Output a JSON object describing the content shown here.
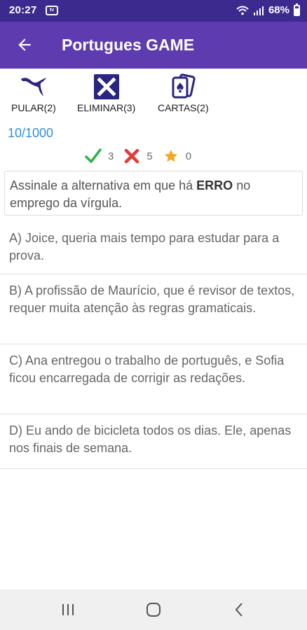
{
  "status": {
    "time": "20:27",
    "notification_icon": "tv-notification-icon",
    "battery": "68%",
    "battery_level": 0.68
  },
  "app_bar": {
    "title": "Portugues GAME",
    "back_icon": "arrow-left-icon"
  },
  "toolbar": {
    "skip_label": "PULAR(2)",
    "eliminate_label": "ELIMINAR(3)",
    "cards_label": "CARTAS(2)",
    "colors": {
      "icon": "#2a2580",
      "text": "#1a1a1a"
    }
  },
  "progress": "10/1000",
  "score": {
    "correct": "3",
    "wrong": "5",
    "stars": "0",
    "colors": {
      "correct": "#2bb34a",
      "wrong": "#e53935",
      "star": "#f5a623"
    }
  },
  "question": {
    "before": "Assinale a alternativa em que há ",
    "emphasis": "ERRO",
    "after": " no emprego da vírgula."
  },
  "options": {
    "a": "A) Joice, queria mais tempo para estudar para a prova.",
    "b": "B) A profissão de Maurício, que é revisor de textos, requer muita atenção às regras gramaticais.",
    "c": "C) Ana entregou o trabalho de português, e Sofia ficou encarregada de corrigir as redações.",
    "d": "D) Eu ando de bicicleta todos os dias. Ele, apenas nos finais de semana."
  },
  "colors": {
    "status_bar": "#3d2a8e",
    "app_bar": "#5e3cb0",
    "progress": "#2f8fdc"
  }
}
